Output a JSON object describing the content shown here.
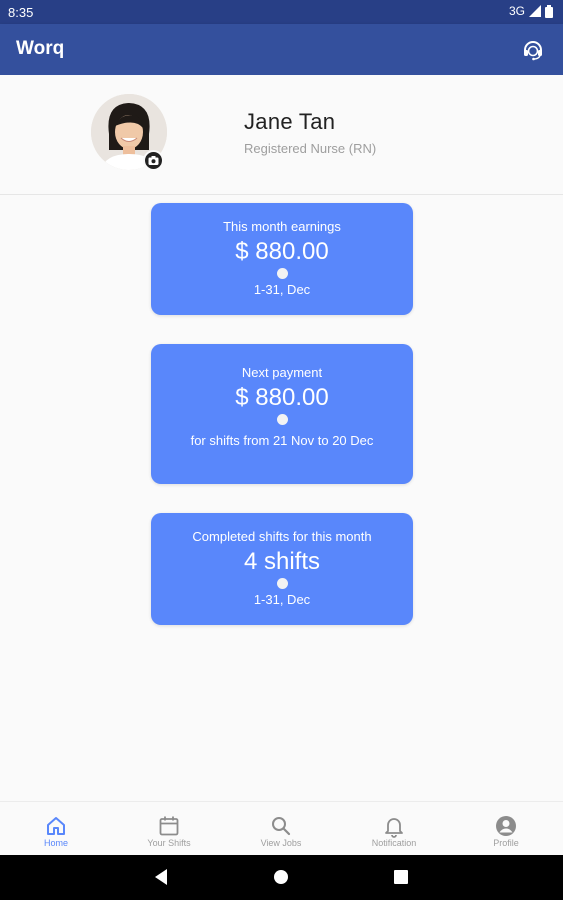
{
  "status_bar": {
    "time": "8:35",
    "network": "3G"
  },
  "app_bar": {
    "title": "Worq",
    "support_icon": "support-agent-icon"
  },
  "profile": {
    "name": "Jane Tan",
    "role": "Registered Nurse (RN)"
  },
  "cards": {
    "earnings": {
      "label": "This month earnings",
      "value": "$ 880.00",
      "sub": "1-31, Dec"
    },
    "payment": {
      "label": "Next payment",
      "value": "$ 880.00",
      "sub": "for shifts from 21 Nov to 20 Dec"
    },
    "shifts": {
      "label": "Completed shifts for this month",
      "value": "4 shifts",
      "sub": "1-31, Dec"
    }
  },
  "bottom_nav": {
    "home": "Home",
    "your_shifts": "Your Shifts",
    "view_jobs": "View Jobs",
    "notification": "Notification",
    "profile": "Profile"
  },
  "colors": {
    "app_bar": "#34509d",
    "status_bar": "#283f86",
    "card": "#5987fb",
    "active_nav": "#5987fb",
    "inactive_nav": "#9e9e9e"
  }
}
